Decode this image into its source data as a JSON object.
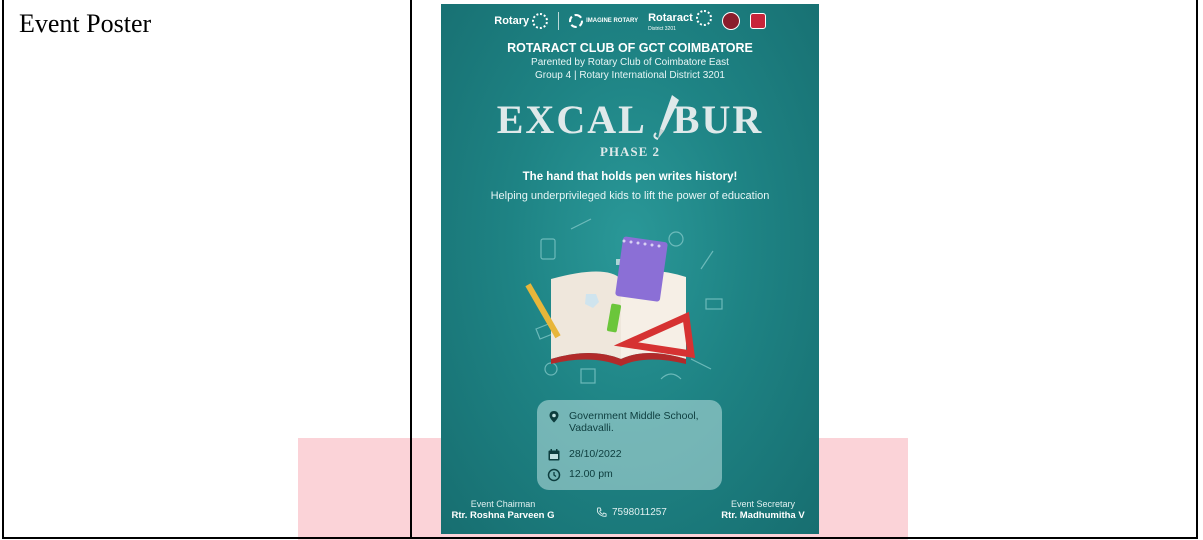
{
  "table": {
    "label": "Event Poster"
  },
  "poster": {
    "logos": {
      "rotary": "Rotary",
      "imagine": "IMAGINE ROTARY",
      "rotaract": "Rotaract",
      "district": "District 3201"
    },
    "club_title": "ROTARACT CLUB OF GCT COIMBATORE",
    "parent_line": "Parented by Rotary Club of Coimbatore East",
    "group_line": "Group 4 | Rotary International District 3201",
    "event_title_left": "EXCAL",
    "event_title_right": "BUR",
    "phase": "PHASE 2",
    "tagline": "The hand that holds pen writes history!",
    "subtagline": "Helping underprivileged kids to lift the power of education",
    "location_line1": "Government Middle School,",
    "location_line2": "Vadavalli.",
    "date": "28/10/2022",
    "time": "12.00 pm",
    "chairman_role": "Event Chairman",
    "chairman_name": "Rtr. Roshna Parveen G",
    "phone": "7598011257",
    "secretary_role": "Event Secretary",
    "secretary_name": "Rtr. Madhumitha V"
  },
  "colors": {
    "poster_teal": "#1e8384",
    "pink_band": "#fbd3d8"
  },
  "icons": [
    "location-pin-icon",
    "calendar-icon",
    "clock-icon",
    "phone-icon",
    "pen-nib-icon"
  ]
}
